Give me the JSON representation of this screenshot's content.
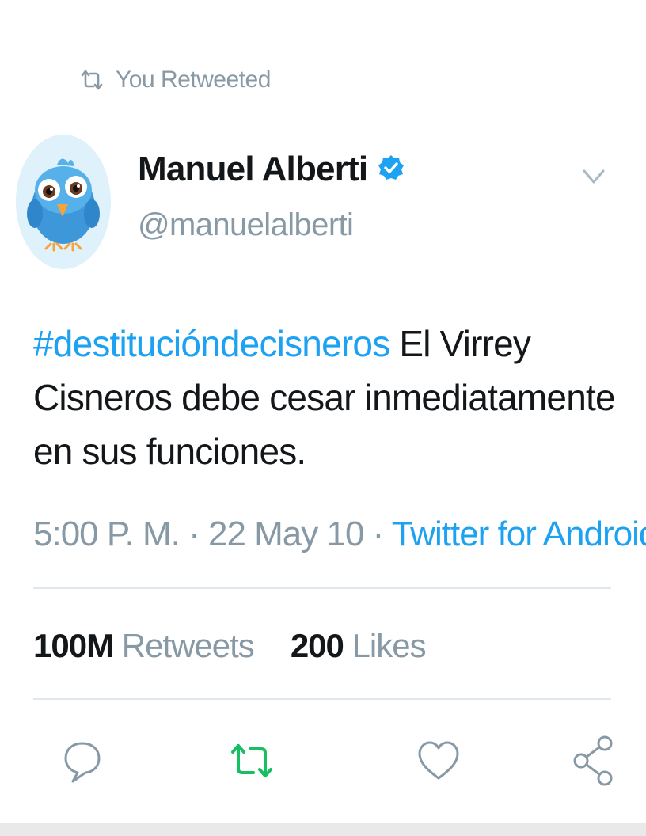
{
  "retweet_context": {
    "label": "You Retweeted",
    "icon": "retweet-icon"
  },
  "author": {
    "display_name": "Manuel Alberti",
    "handle": "@manuelalberti",
    "verified": true,
    "verified_icon": "verified-badge-icon",
    "avatar": "bird-avatar"
  },
  "tweet": {
    "hashtag": "#destituciondecisneros",
    "hashtag_display": "#destituciónde​cisneros",
    "text_after_hashtag": " El Virrey Cisneros debe cesar inmediatamente en sus funciones.",
    "time": "5:00 P. M.",
    "separator": " · ",
    "date": "22 May 10",
    "source": "Twitter for Android"
  },
  "stats": {
    "retweets_count": "100M",
    "retweets_label": "Retweets",
    "likes_count": "200",
    "likes_label": "Likes"
  },
  "actions": [
    {
      "name": "reply",
      "icon": "reply-icon"
    },
    {
      "name": "retweet",
      "icon": "retweet-icon",
      "active": true
    },
    {
      "name": "like",
      "icon": "heart-icon"
    },
    {
      "name": "share",
      "icon": "share-icon"
    }
  ],
  "colors": {
    "accent": "#1da1f2",
    "muted": "#8899a6",
    "text": "#14171a",
    "retweet_active": "#17bf63",
    "divider": "#e1e8ed"
  }
}
